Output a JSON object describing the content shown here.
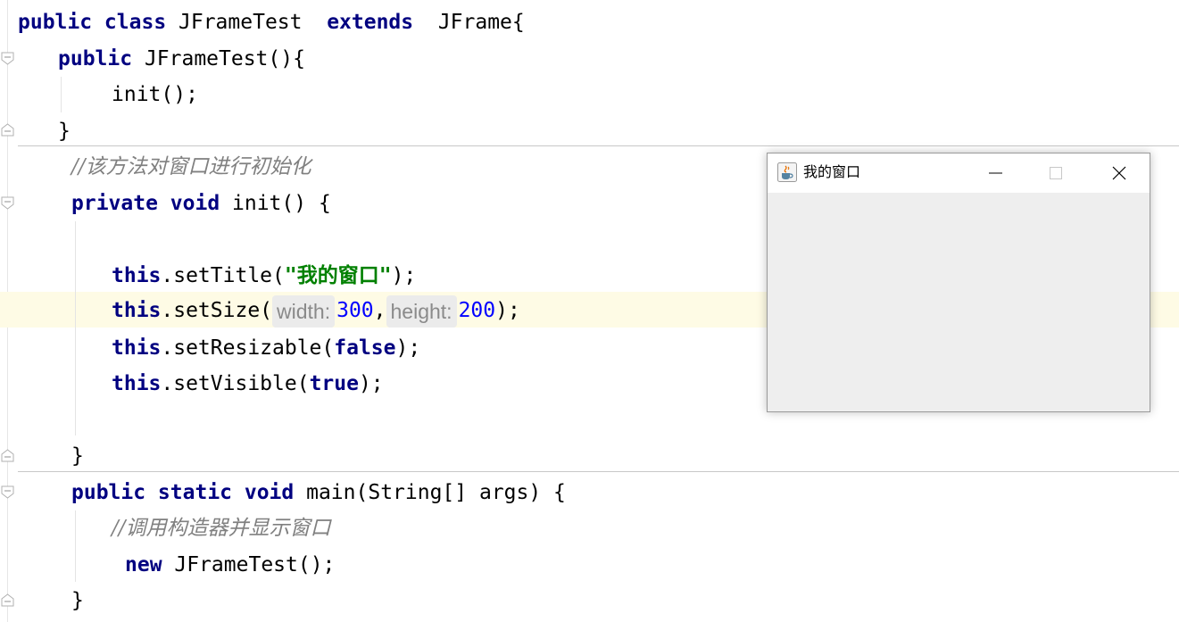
{
  "editor": {
    "lines": [
      {
        "id": "l1",
        "tokens": [
          [
            "kw",
            "public class "
          ],
          [
            "",
            "JFrameTest  "
          ],
          [
            "kw",
            "extends"
          ],
          [
            "",
            "  JFrame{"
          ]
        ]
      },
      {
        "id": "l2",
        "tokens": [
          [
            "kw",
            "public "
          ],
          [
            "",
            "JFrameTest(){"
          ]
        ]
      },
      {
        "id": "l3",
        "tokens": [
          [
            "",
            "init();"
          ]
        ]
      },
      {
        "id": "l4",
        "tokens": [
          [
            "",
            "}"
          ]
        ]
      },
      {
        "id": "l5",
        "tokens": [
          [
            "cmt",
            "//该方法对窗口进行初始化"
          ]
        ]
      },
      {
        "id": "l6",
        "tokens": [
          [
            "kw",
            "private void "
          ],
          [
            "",
            "init() {"
          ]
        ]
      },
      {
        "id": "l7",
        "tokens": []
      },
      {
        "id": "l8",
        "tokens": [
          [
            "kw",
            "this"
          ],
          [
            "",
            ".setTitle("
          ],
          [
            "str",
            "\"我的窗口\""
          ],
          [
            "",
            ");"
          ]
        ]
      },
      {
        "id": "l9",
        "tokens": [
          [
            "kw",
            "this"
          ],
          [
            "",
            ".setSize("
          ],
          [
            "hint",
            "width:"
          ],
          [
            "num",
            "300"
          ],
          [
            "",
            ","
          ],
          [
            "hint",
            "height:"
          ],
          [
            "num",
            "200"
          ],
          [
            "",
            ");"
          ]
        ]
      },
      {
        "id": "l10",
        "tokens": [
          [
            "kw",
            "this"
          ],
          [
            "",
            ".setResizable("
          ],
          [
            "kw",
            "false"
          ],
          [
            "",
            ");"
          ]
        ]
      },
      {
        "id": "l11",
        "tokens": [
          [
            "kw",
            "this"
          ],
          [
            "",
            ".setVisible("
          ],
          [
            "kw",
            "true"
          ],
          [
            "",
            ");"
          ]
        ]
      },
      {
        "id": "l12",
        "tokens": []
      },
      {
        "id": "l13",
        "tokens": [
          [
            "",
            "}"
          ]
        ]
      },
      {
        "id": "l14",
        "tokens": [
          [
            "kw",
            "public static void "
          ],
          [
            "",
            "main(String[] args) {"
          ]
        ]
      },
      {
        "id": "l15",
        "tokens": [
          [
            "cmt",
            "//调用构造器并显示窗口"
          ]
        ]
      },
      {
        "id": "l16",
        "tokens": [
          [
            "kw",
            "new "
          ],
          [
            "",
            "JFrameTest();"
          ]
        ]
      },
      {
        "id": "l17",
        "tokens": [
          [
            "",
            "}"
          ]
        ]
      }
    ]
  },
  "window": {
    "title": "我的窗口",
    "icon": "java-coffee-icon",
    "minimize_icon": "minimize-icon",
    "maximize_icon": "maximize-icon",
    "close_icon": "close-icon"
  },
  "colors": {
    "keyword": "#000080",
    "number": "#0000ff",
    "string": "#008000",
    "comment": "#808080",
    "current_line": "#fefbe5"
  }
}
